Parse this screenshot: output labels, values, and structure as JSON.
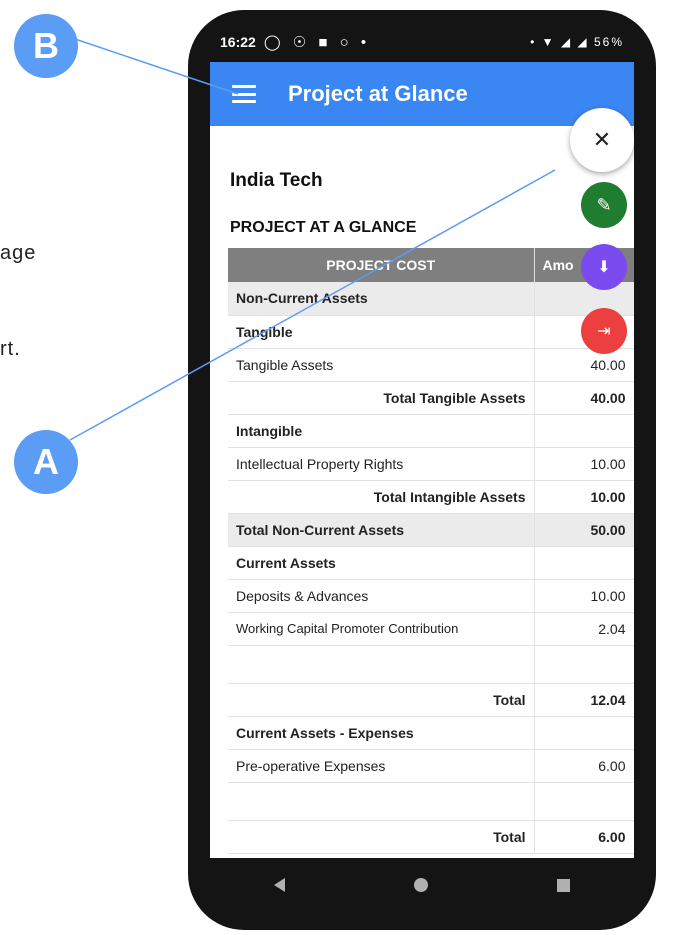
{
  "side_text": {
    "line1": "age",
    "line2": "rt."
  },
  "callouts": {
    "a": "A",
    "b": "B"
  },
  "status_bar": {
    "time": "16:22",
    "left_icons": "◯ ☉ ■ ○ •",
    "right_icons": "• ▼ ◢ ◢ 56%"
  },
  "app_bar": {
    "title": "Project at Glance",
    "menu_icon": "hamburger-menu-icon"
  },
  "content": {
    "company": "India Tech",
    "section_title": "PROJECT AT A GLANCE",
    "table": {
      "headers": [
        "PROJECT COST",
        "Amo"
      ],
      "rows": [
        {
          "label": "Non-Current Assets",
          "amount": ""
        },
        {
          "label": "Tangible",
          "amount": ""
        },
        {
          "label": "Tangible Assets",
          "amount": "40.00"
        },
        {
          "label": "Total Tangible Assets",
          "amount": "40.00"
        },
        {
          "label": "Intangible",
          "amount": ""
        },
        {
          "label": "Intellectual Property Rights",
          "amount": "10.00"
        },
        {
          "label": "Total Intangible Assets",
          "amount": "10.00"
        },
        {
          "label": "Total Non-Current Assets",
          "amount": "50.00"
        },
        {
          "label": "Current Assets",
          "amount": ""
        },
        {
          "label": "Deposits & Advances",
          "amount": "10.00"
        },
        {
          "label": "Working Capital Promoter Contribution",
          "amount": "2.04"
        },
        {
          "label": "",
          "amount": ""
        },
        {
          "label": "Total",
          "amount": "12.04"
        },
        {
          "label": "Current Assets - Expenses",
          "amount": ""
        },
        {
          "label": "Pre-operative Expenses",
          "amount": "6.00"
        },
        {
          "label": "",
          "amount": ""
        },
        {
          "label": "Total",
          "amount": "6.00"
        }
      ]
    }
  },
  "fab": {
    "close": "✕",
    "edit": "✎",
    "download": "⬇",
    "exit": "⇥"
  },
  "colors": {
    "app_bar": "#3a86f2",
    "callout": "#5b9cf4",
    "fab_edit": "#1e7d2e",
    "fab_download": "#7b4bf0",
    "fab_exit": "#ec3f3f"
  }
}
